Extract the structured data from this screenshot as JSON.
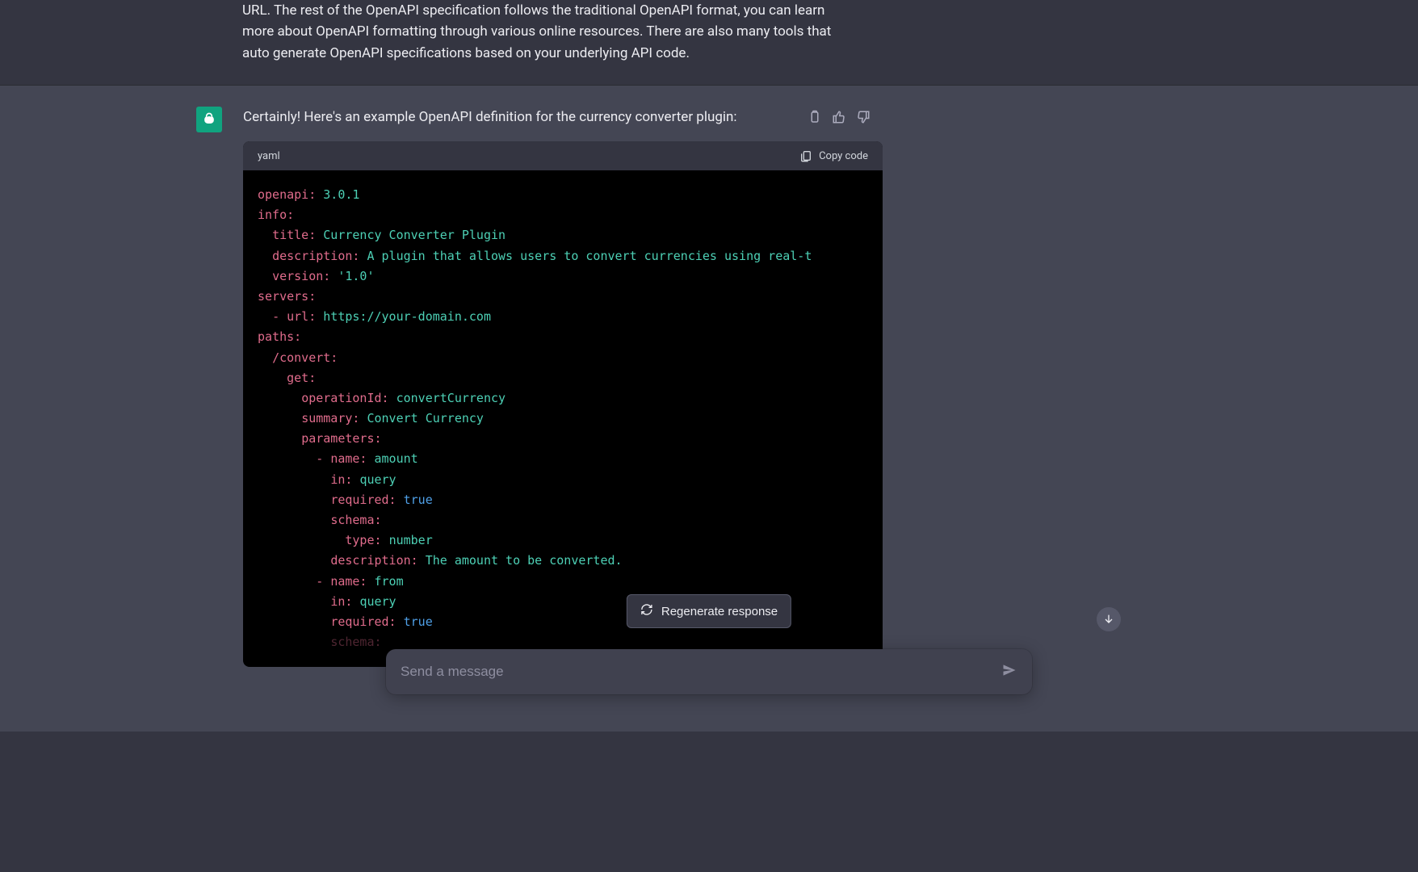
{
  "top_paragraph": "URL. The rest of the OpenAPI specification follows the traditional OpenAPI format, you can learn more about OpenAPI formatting through various online resources. There are also many tools that auto generate OpenAPI specifications based on your underlying API code.",
  "response_intro": "Certainly! Here's an example OpenAPI definition for the currency converter plugin:",
  "code": {
    "lang": "yaml",
    "copy_label": "Copy code",
    "lines": [
      {
        "key": "openapi:",
        "val": "3.0.1",
        "type": "num",
        "indent": 0
      },
      {
        "key": "info:",
        "val": "",
        "indent": 0
      },
      {
        "key": "title:",
        "val": "Currency Converter Plugin",
        "type": "str",
        "indent": 1
      },
      {
        "key": "description:",
        "val": "A plugin that allows users to convert currencies using real-t",
        "type": "str",
        "indent": 1
      },
      {
        "key": "version:",
        "val": "'1.0'",
        "type": "str",
        "indent": 1
      },
      {
        "key": "servers:",
        "val": "",
        "indent": 0
      },
      {
        "dash": true,
        "key": "url:",
        "val": "https://your-domain.com",
        "type": "str",
        "indent": 1
      },
      {
        "key": "paths:",
        "val": "",
        "indent": 0
      },
      {
        "key": "/convert:",
        "val": "",
        "indent": 1
      },
      {
        "key": "get:",
        "val": "",
        "indent": 2
      },
      {
        "key": "operationId:",
        "val": "convertCurrency",
        "type": "str",
        "indent": 3
      },
      {
        "key": "summary:",
        "val": "Convert Currency",
        "type": "str",
        "indent": 3
      },
      {
        "key": "parameters:",
        "val": "",
        "indent": 3
      },
      {
        "dash": true,
        "key": "name:",
        "val": "amount",
        "type": "str",
        "indent": 4
      },
      {
        "key": "in:",
        "val": "query",
        "type": "str",
        "indent": 5
      },
      {
        "key": "required:",
        "val": "true",
        "type": "bool",
        "indent": 5
      },
      {
        "key": "schema:",
        "val": "",
        "indent": 5
      },
      {
        "key": "type:",
        "val": "number",
        "type": "str",
        "indent": 6
      },
      {
        "key": "description:",
        "val": "The amount to be converted.",
        "type": "str",
        "indent": 5
      },
      {
        "dash": true,
        "key": "name:",
        "val": "from",
        "type": "str",
        "indent": 4
      },
      {
        "key": "in:",
        "val": "query",
        "type": "str",
        "indent": 5
      },
      {
        "key": "required:",
        "val": "true",
        "type": "bool",
        "indent": 5
      },
      {
        "key": "schema:",
        "val": "",
        "indent": 5,
        "fade": true
      }
    ]
  },
  "regenerate_label": "Regenerate response",
  "input_placeholder": "Send a message"
}
